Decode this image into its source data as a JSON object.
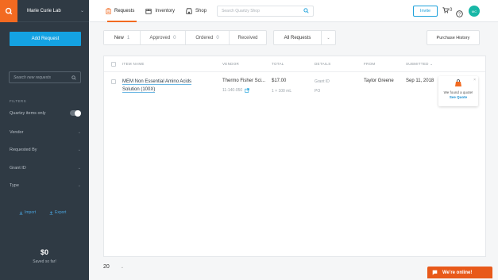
{
  "sidebar": {
    "lab_name": "Marie Curie Lab",
    "add_request": "Add Request",
    "search_placeholder": "Search new requests",
    "filters_title": "FILTERS",
    "quartzy_only": "Quartzy items only",
    "filters": [
      "Vendor",
      "Requested By",
      "Grant ID",
      "Type"
    ],
    "import": "Import",
    "export": "Export",
    "savings_amount": "$0",
    "savings_label": "Saved so far!"
  },
  "topbar": {
    "nav": {
      "requests": "Requests",
      "inventory": "Inventory",
      "shop": "Shop"
    },
    "search_placeholder": "Search Quartzy Shop",
    "invite": "Invite",
    "cart_count": "0",
    "avatar_initials": "MC"
  },
  "status_tabs": [
    {
      "label": "New",
      "count": "1"
    },
    {
      "label": "Approved",
      "count": "0"
    },
    {
      "label": "Ordered",
      "count": "0"
    },
    {
      "label": "Received",
      "count": ""
    }
  ],
  "request_filter": "All Requests",
  "purchase_history": "Purchase History",
  "table": {
    "headers": {
      "item": "ITEM NAME",
      "vendor": "VENDOR",
      "total": "TOTAL",
      "details": "DETAILS",
      "from": "FROM",
      "submitted": "SUBMITTED"
    },
    "rows": [
      {
        "item_line1": "MEM Non Essential Amino Acids",
        "item_line2": "Solution (100X)",
        "vendor": "Thermo Fisher Sci...",
        "catalog": "11-140-050",
        "total": "$17.00",
        "qty": "1 × 100 mL",
        "grant": "Grant ID",
        "po": "PO",
        "from": "Taylor Greene",
        "submitted": "Sep 11, 2018"
      }
    ]
  },
  "quote_card": {
    "message": "We found a quote!",
    "link": "See Quote"
  },
  "pager": {
    "page_size": "20"
  },
  "chat": {
    "label": "We're online!"
  },
  "colors": {
    "brand_orange": "#f26a21",
    "primary_blue": "#14a2e2",
    "sidebar_bg": "#2f3a44"
  }
}
